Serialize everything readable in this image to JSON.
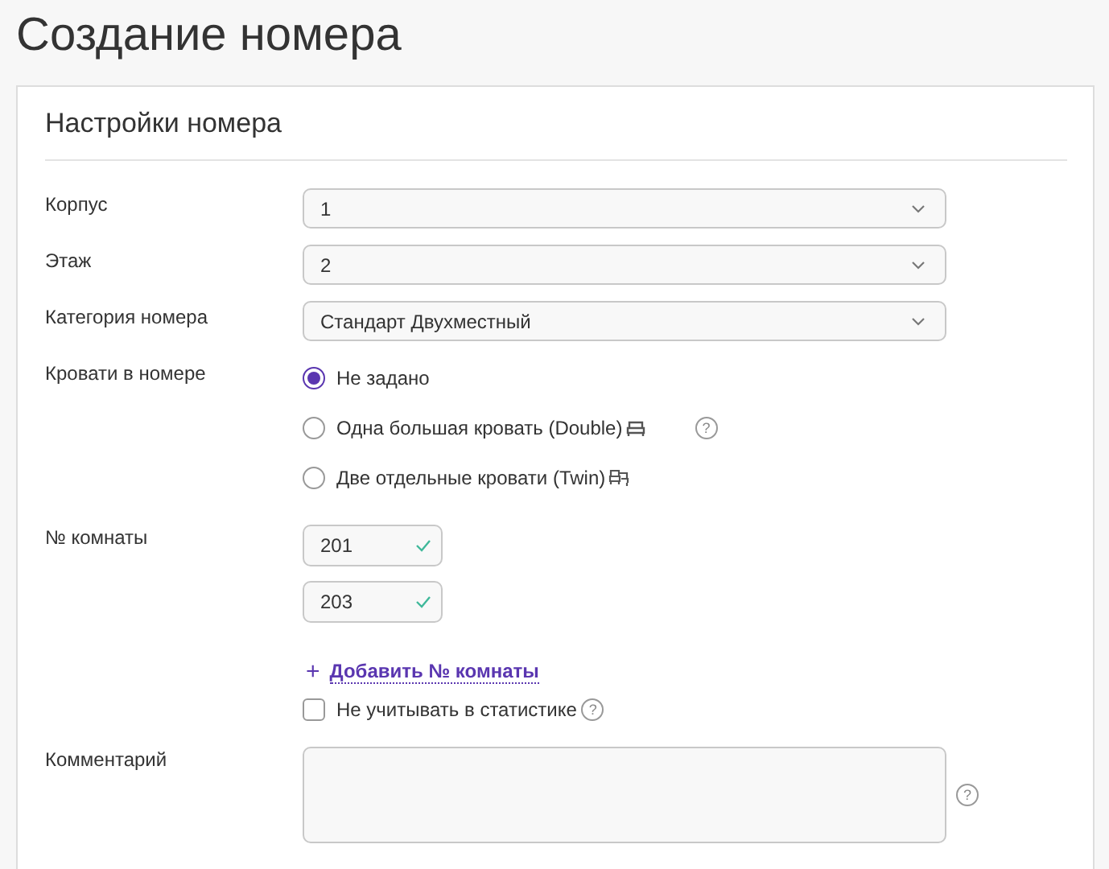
{
  "page_title": "Создание номера",
  "section": {
    "title": "Настройки номера"
  },
  "selects": [
    {
      "label": "Корпус",
      "value": "1"
    },
    {
      "label": "Этаж",
      "value": "2"
    },
    {
      "label": "Категория номера",
      "value": "Стандарт Двухместный"
    }
  ],
  "beds": {
    "label": "Кровати в номере",
    "options": [
      {
        "label": "Не задано",
        "selected": true,
        "kind": "plain"
      },
      {
        "label": "Одна большая кровать (Double)",
        "selected": false,
        "kind": "double",
        "help": "?"
      },
      {
        "label": "Две отдельные кровати (Twin)",
        "selected": false,
        "kind": "twin"
      }
    ]
  },
  "rooms": {
    "label": "№ комнаты",
    "numbers": [
      {
        "value": "201",
        "valid": true
      },
      {
        "value": "203",
        "valid": true
      }
    ],
    "add_link": {
      "icon": "+",
      "label": "Добавить № комнаты"
    },
    "exclude_stats": {
      "label": "Не учитывать в статистике",
      "checked": false,
      "help": "?"
    }
  },
  "comment": {
    "label": "Комментарий",
    "help": "?"
  }
}
